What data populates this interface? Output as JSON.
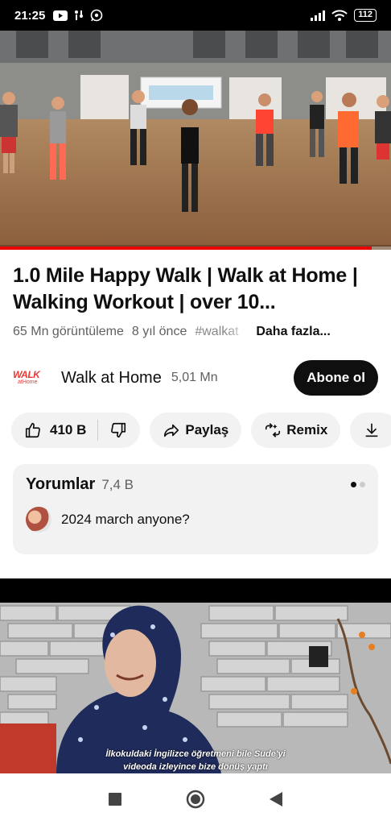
{
  "status_bar": {
    "time": "21:25",
    "battery": "112"
  },
  "video": {
    "progress_fraction": 0.95
  },
  "title": "1.0 Mile Happy Walk | Walk at Home | Walking Workout | over 10...",
  "meta": {
    "views": "65 Mn görüntüleme",
    "age": "8 yıl önce",
    "hashtag": "#walkat",
    "more_label": "Daha fazla..."
  },
  "channel": {
    "logo_text": "WALK",
    "logo_subtext": "atHome",
    "name": "Walk at Home",
    "subscribers": "5,01 Mn",
    "subscribe_label": "Abone ol"
  },
  "actions": {
    "like_count": "410 B",
    "share_label": "Paylaş",
    "remix_label": "Remix"
  },
  "comments": {
    "title": "Yorumlar",
    "count": "7,4 B",
    "top_comment": "2024 march anyone?"
  },
  "next_video": {
    "caption_line1": "İlkokuldaki İngilizce öğretmeni bile Sude'yi",
    "caption_line2": "videoda izleyince bize dönüş yaptı"
  },
  "colors": {
    "accent": "#ff0000",
    "chip_bg": "#f2f2f2",
    "logo": "#e53935"
  }
}
